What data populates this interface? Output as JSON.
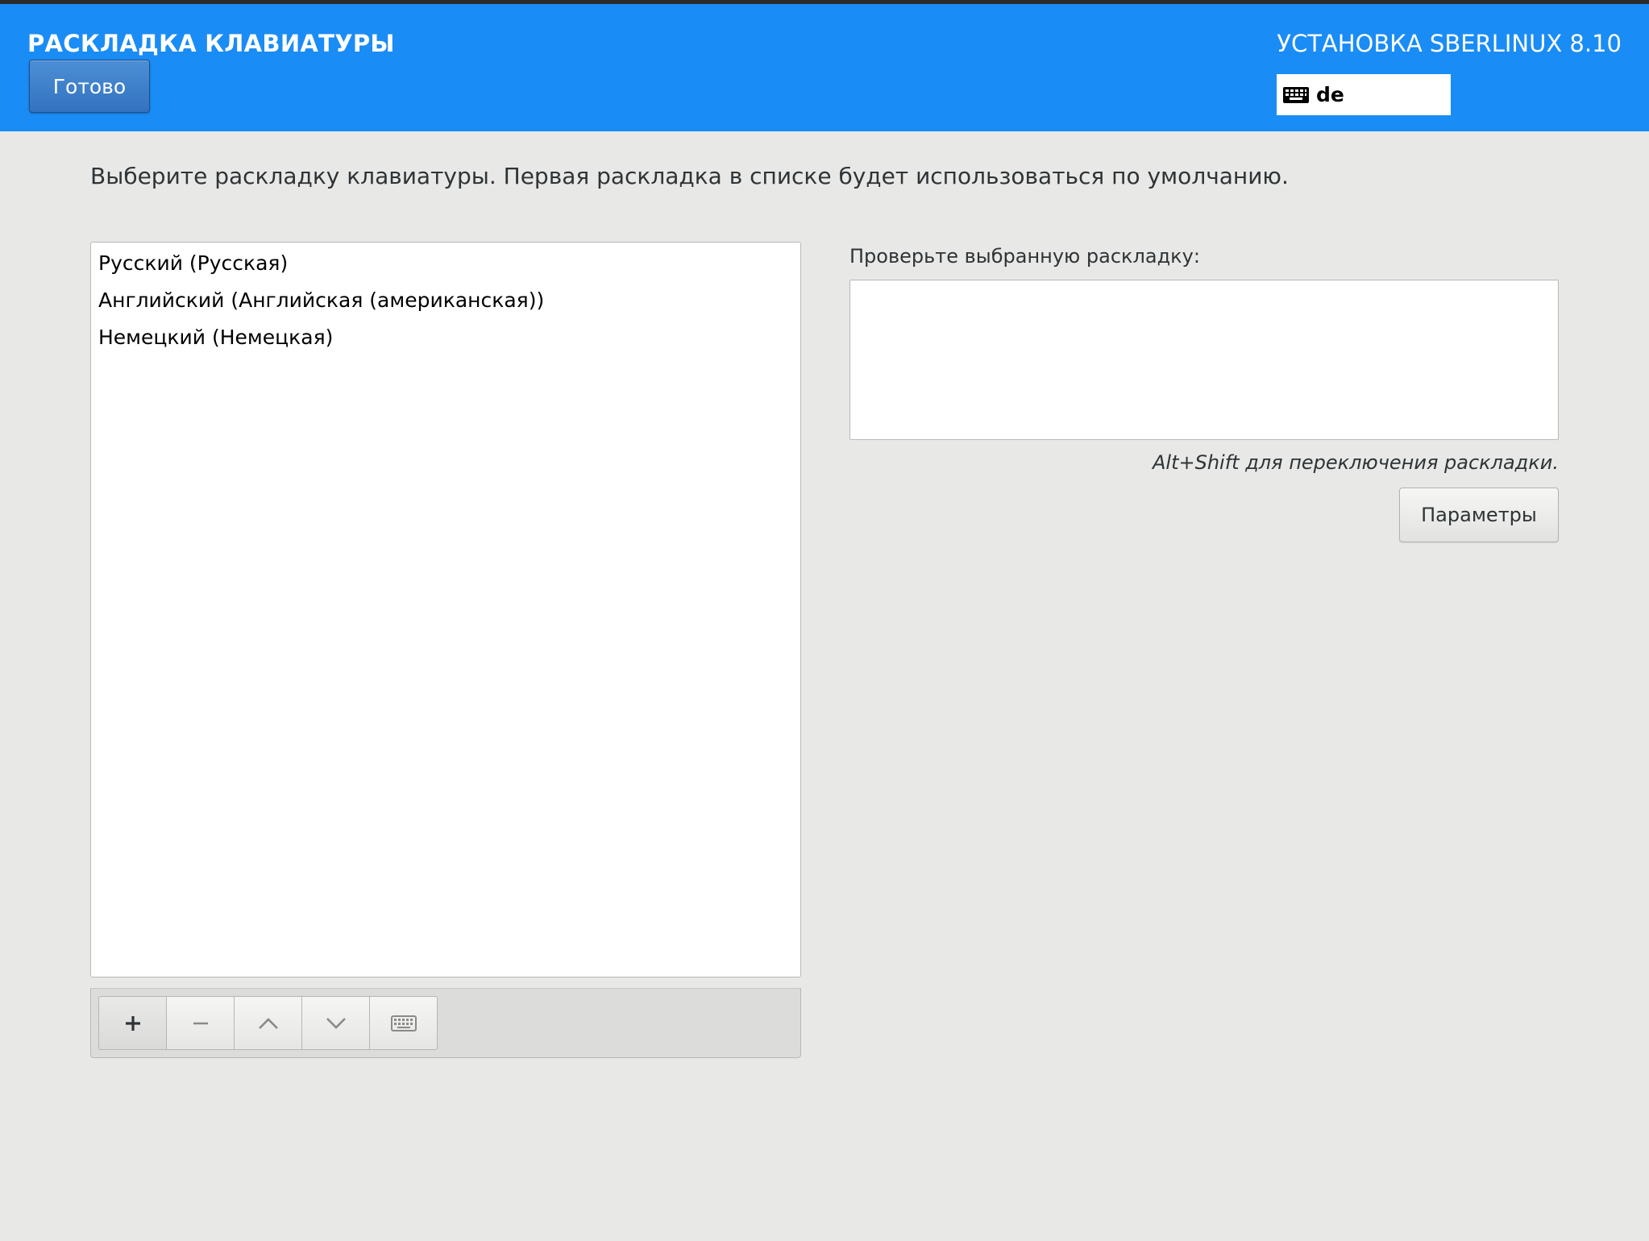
{
  "header": {
    "title": "РАСКЛАДКА КЛАВИАТУРЫ",
    "done_label": "Готово",
    "product": "УСТАНОВКА SBERLINUX 8.10",
    "layout_indicator": {
      "icon": "keyboard-icon",
      "code": "de"
    },
    "accent_color": "#1a8cf5"
  },
  "main": {
    "instructions": "Выберите раскладку клавиатуры. Первая раскладка в списке будет использоваться по умолчанию.",
    "layouts": [
      {
        "label": "Русский (Русская)"
      },
      {
        "label": "Английский (Английская (американская))"
      },
      {
        "label": "Немецкий (Немецкая)"
      }
    ],
    "toolbar": [
      {
        "name": "add-layout-button",
        "icon": "plus-icon"
      },
      {
        "name": "remove-layout-button",
        "icon": "minus-icon"
      },
      {
        "name": "move-up-button",
        "icon": "chevron-up-icon"
      },
      {
        "name": "move-down-button",
        "icon": "chevron-down-icon"
      },
      {
        "name": "preview-layout-button",
        "icon": "keyboard-icon"
      }
    ],
    "test_label": "Проверьте выбранную раскладку:",
    "test_value": "",
    "switch_hint": "Alt+Shift для переключения раскладки.",
    "options_label": "Параметры"
  }
}
